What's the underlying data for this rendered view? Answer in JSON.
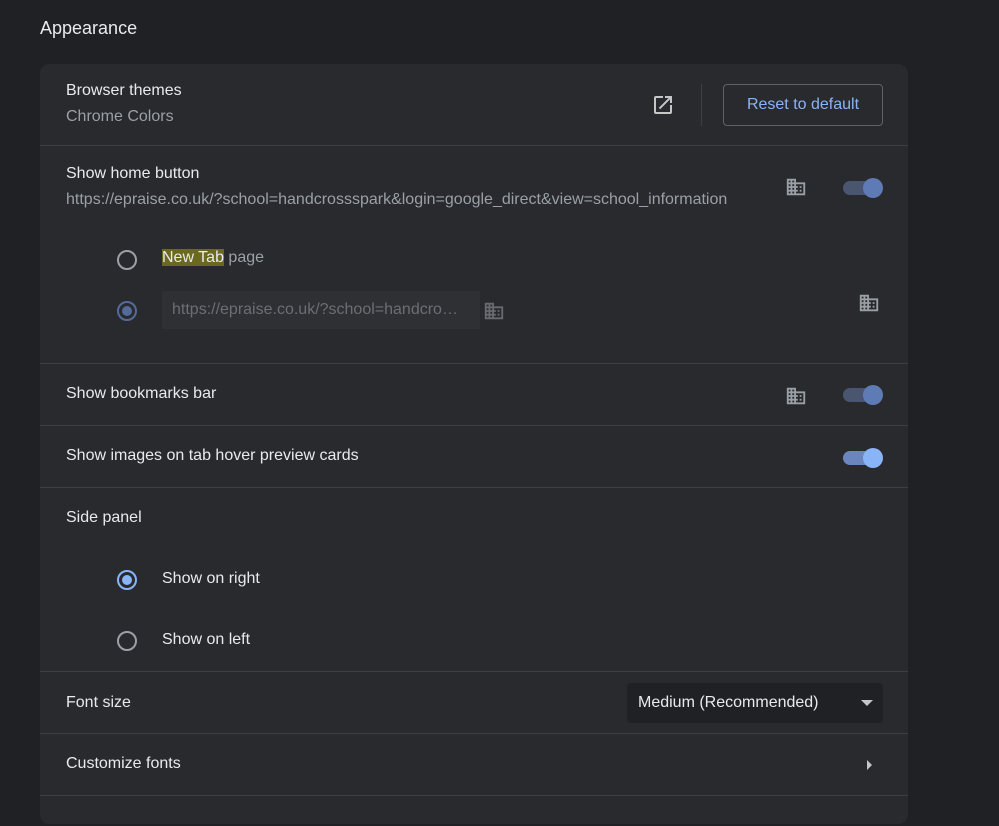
{
  "section": {
    "title": "Appearance"
  },
  "themes": {
    "label": "Browser themes",
    "value": "Chrome Colors",
    "open_icon": "open-in-new-icon",
    "reset_label": "Reset to default"
  },
  "home_button": {
    "label": "Show home button",
    "url": "https://epraise.co.uk/?school=handcrossspark&login=google_direct&view=school_information",
    "enabled": true,
    "option_new_tab_highlight": "New Tab",
    "option_new_tab_rest": " page",
    "custom_url_value": "https://epraise.co.uk/?school=handcro…",
    "selected_option": "custom"
  },
  "bookmarks_bar": {
    "label": "Show bookmarks bar",
    "enabled": true
  },
  "tab_hover": {
    "label": "Show images on tab hover preview cards",
    "enabled": true
  },
  "side_panel": {
    "label": "Side panel",
    "options": [
      "Show on right",
      "Show on left"
    ],
    "selected": "Show on right"
  },
  "font_size": {
    "label": "Font size",
    "value": "Medium (Recommended)"
  },
  "customize_fonts": {
    "label": "Customize fonts"
  },
  "colors": {
    "background": "#202124",
    "card": "#292a2d",
    "accent": "#8ab4f8",
    "text_primary": "#e8eaed",
    "text_secondary": "#9aa0a6"
  }
}
